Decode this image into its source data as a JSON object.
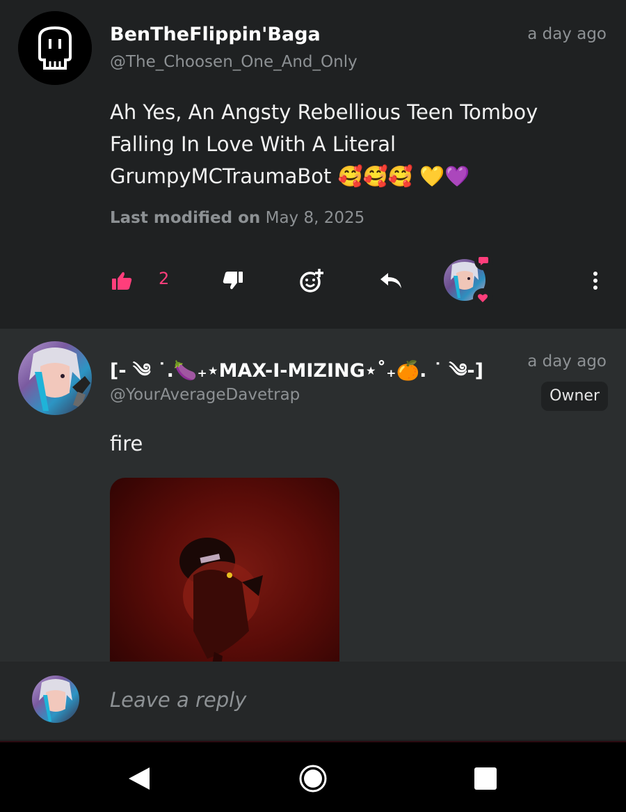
{
  "comments": [
    {
      "author": "BenTheFlippin'Baga",
      "handle": "@The_Choosen_One_And_Only",
      "time": "a day ago",
      "body": "Ah Yes, An Angsty Rebellious Teen Tomboy Falling In Love With A Literal GrumpyMCTraumaBot 🥰🥰🥰 💛💜",
      "modified_label": "Last modified on",
      "modified_date": "May 8, 2025",
      "likes": "2",
      "avatar_icon": "skull-icon"
    },
    {
      "author": "[- ༄ ˙.🍆₊⋆MAX-I-MIZING⋆˚₊🍊. ˙ ༄-]",
      "handle": "@YourAverageDavetrap",
      "time": "a day ago",
      "badge": "Owner",
      "body": "fire",
      "attachment_icon": "gif-thumbnail"
    }
  ],
  "reply": {
    "placeholder": "Leave a reply"
  },
  "colors": {
    "accent": "#ff3e7b",
    "background": "#1f2122",
    "secondary_background": "#2b2e2f",
    "muted_text": "#8d9194"
  }
}
